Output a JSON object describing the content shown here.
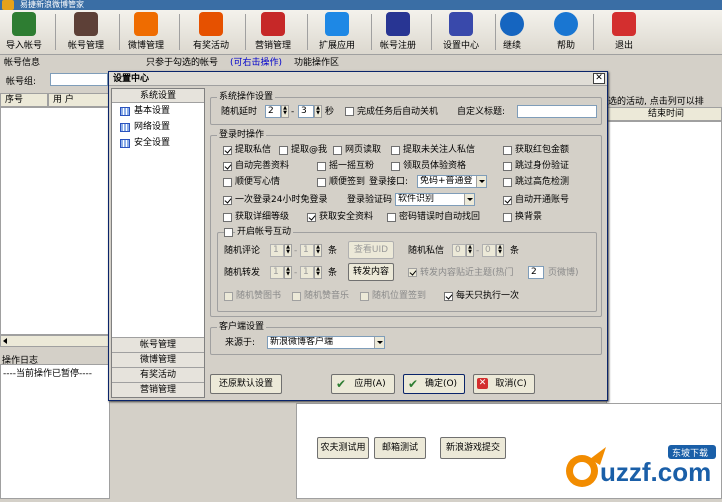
{
  "window": {
    "title": "易捷新浪微博管家"
  },
  "toolbar": [
    {
      "label": "导入帐号",
      "icon": "import-icon",
      "color": "#2e7d32"
    },
    {
      "label": "帐号管理",
      "icon": "account-manage-icon",
      "color": "#5d4037"
    },
    {
      "label": "微博管理",
      "icon": "weibo-manage-icon",
      "color": "#ef6c00"
    },
    {
      "label": "有奖活动",
      "icon": "prize-activity-icon",
      "color": "#e65100"
    },
    {
      "label": "营销管理",
      "icon": "marketing-icon",
      "color": "#c62828"
    },
    {
      "label": "扩展应用",
      "icon": "extension-icon",
      "color": "#1e88e5"
    },
    {
      "label": "帐号注册",
      "icon": "register-icon",
      "color": "#283593"
    },
    {
      "label": "设置中心",
      "icon": "settings-icon",
      "color": "#3949ab"
    },
    {
      "label": "继续",
      "icon": "play-icon",
      "color": "#1565c0"
    },
    {
      "label": "帮助",
      "icon": "help-icon",
      "color": "#1976d2"
    },
    {
      "label": "退出",
      "icon": "exit-icon",
      "color": "#d32f2f"
    }
  ],
  "infobar": {
    "account_info": "帐号信息",
    "hint": "只参于勾选的帐号",
    "link": "(可右击操作)",
    "func_area": "功能操作区"
  },
  "left": {
    "group_label": "帐号组:",
    "col_seq": "序号",
    "col_user": "用 户",
    "log_title": "操作日志",
    "log_text": "----当前操作已暂停----"
  },
  "right": {
    "hint": "选的活动, 点击列可以排",
    "col_end": "结束时间"
  },
  "dialog": {
    "title": "设置中心",
    "close": "✕",
    "nav": {
      "header": "系统设置",
      "items": [
        "基本设置",
        "网络设置",
        "安全设置"
      ],
      "bottom": [
        "帐号管理",
        "微博管理",
        "有奖活动",
        "营销管理"
      ]
    },
    "sys": {
      "title": "系统操作设置",
      "delay_label": "随机延时",
      "delay_min": "2",
      "dash": "-",
      "delay_max": "3",
      "sec": "秒",
      "shutdown": "完成任务后自动关机",
      "custom_title": "自定义标题:",
      "custom_title_value": ""
    },
    "login": {
      "title": "登录时操作",
      "row1": [
        "提取私信",
        "提取@我",
        "网页读取",
        "提取未关注人私信",
        "获取红包金额"
      ],
      "row2": [
        "自动完善资料",
        "摇一摇互粉",
        "领取员体验资格",
        "跳过身份验证"
      ],
      "row3": [
        "顺便写心情",
        "顺便签到",
        "跳过高危检测"
      ],
      "login_port_label": "登录接口:",
      "login_port_value": "免码+普通登",
      "row4": [
        "一次登录24小时免登录",
        "自动开通账号"
      ],
      "captcha_label": "登录验证码",
      "captcha_value": "软件识别",
      "row5": [
        "获取详细等级",
        "获取安全资料",
        "密码错误时自动找回",
        "换背景"
      ]
    },
    "account": {
      "title": "开启帐号互动",
      "comment_label": "随机评论",
      "comment_min": "1",
      "comment_max": "1",
      "unit": "条",
      "view_uid": "查看UID",
      "dm_label": "随机私信",
      "dm_min": "0",
      "dm_max": "0",
      "repost_label": "随机转发",
      "repost_min": "1",
      "repost_max": "1",
      "repost_content": "转发内容",
      "hot_topic_pre": "转发内容贴近主题(热门",
      "hot_topic_num": "2",
      "hot_topic_post": "页微博)",
      "row_bottom": [
        "随机赞图书",
        "随机赞音乐",
        "随机位置签到",
        "每天只执行一次"
      ]
    },
    "client": {
      "title": "客户端设置",
      "source_label": "来源于:",
      "source_value": "新浪微博客户端"
    },
    "buttons": {
      "restore": "还原默认设置",
      "apply": "应用(A)",
      "ok": "确定(O)",
      "cancel": "取消(C)"
    }
  },
  "bottom_buttons": [
    "农夫测试用",
    "邮箱测试",
    "新浪游戏提交"
  ],
  "logo": {
    "text": "uzzf.com",
    "sub": "东坡下载"
  }
}
